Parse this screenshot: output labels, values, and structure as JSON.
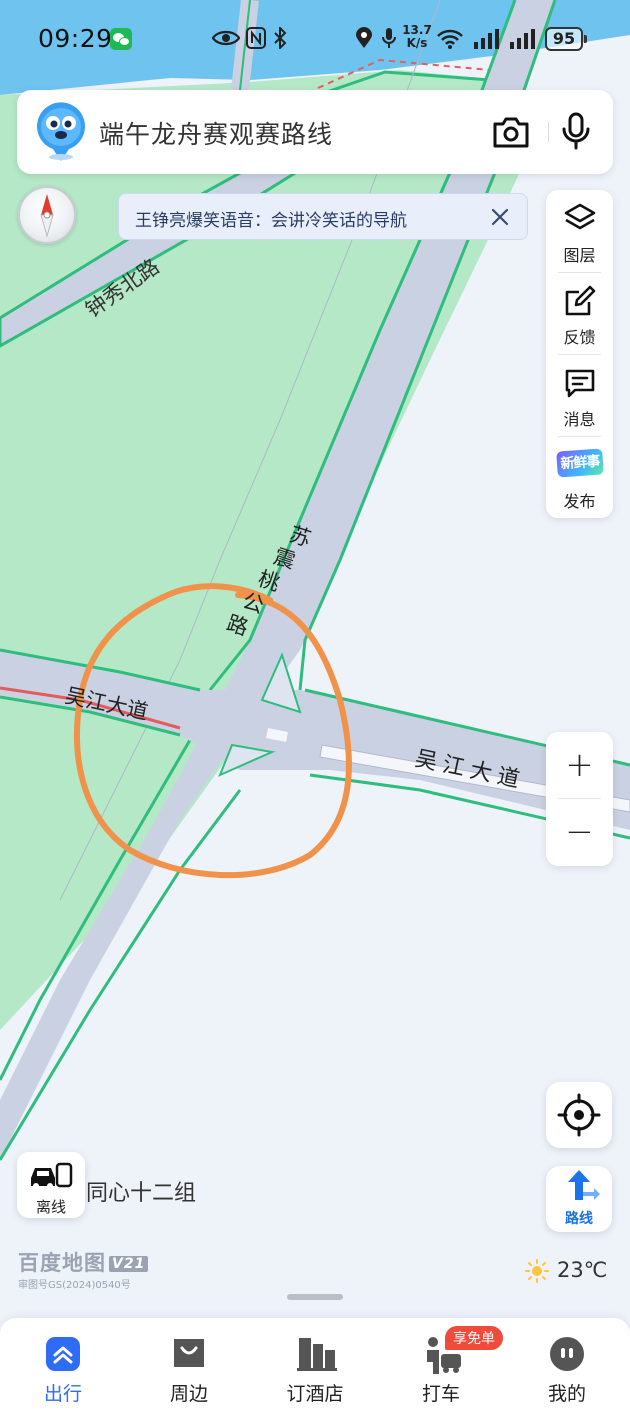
{
  "status_bar": {
    "time": "09:29",
    "net_speed_value": "13.7",
    "net_speed_unit": "K/s",
    "battery": "95"
  },
  "search": {
    "text": "端午龙舟赛观赛路线"
  },
  "notice": {
    "text": "王铮亮爆笑语音：会讲冷笑话的导航"
  },
  "tools": {
    "layers": "图层",
    "feedback": "反馈",
    "messages": "消息",
    "fresh_badge": "新鲜事",
    "publish": "发布"
  },
  "zoom": {
    "in": "+",
    "out": "−"
  },
  "route": {
    "label": "路线"
  },
  "offline": {
    "label": "离线",
    "place": "同心十二组"
  },
  "map": {
    "road_zhongxiu": "钟秀北路",
    "road_suzhentao": "苏震桃公路",
    "road_wujiang_left": "吴江大道",
    "road_wujiang_right": "吴江大道"
  },
  "logo": {
    "name": "百度地图",
    "version": "V21",
    "review_no": "审图号GS(2024)0540号"
  },
  "weather": {
    "temperature": "23℃"
  },
  "bottom_nav": {
    "items": [
      {
        "label": "出行"
      },
      {
        "label": "周边"
      },
      {
        "label": "订酒店"
      },
      {
        "label": "打车",
        "badge": "享免单"
      },
      {
        "label": "我的"
      }
    ]
  },
  "colors": {
    "road_fill": "#c9d1e2",
    "road_edge": "#2ebd7c",
    "park_green": "#b4e8c6",
    "water": "#6ec3ef",
    "annotation_circle": "#f0924a",
    "accent_blue": "#2e6cf6"
  }
}
